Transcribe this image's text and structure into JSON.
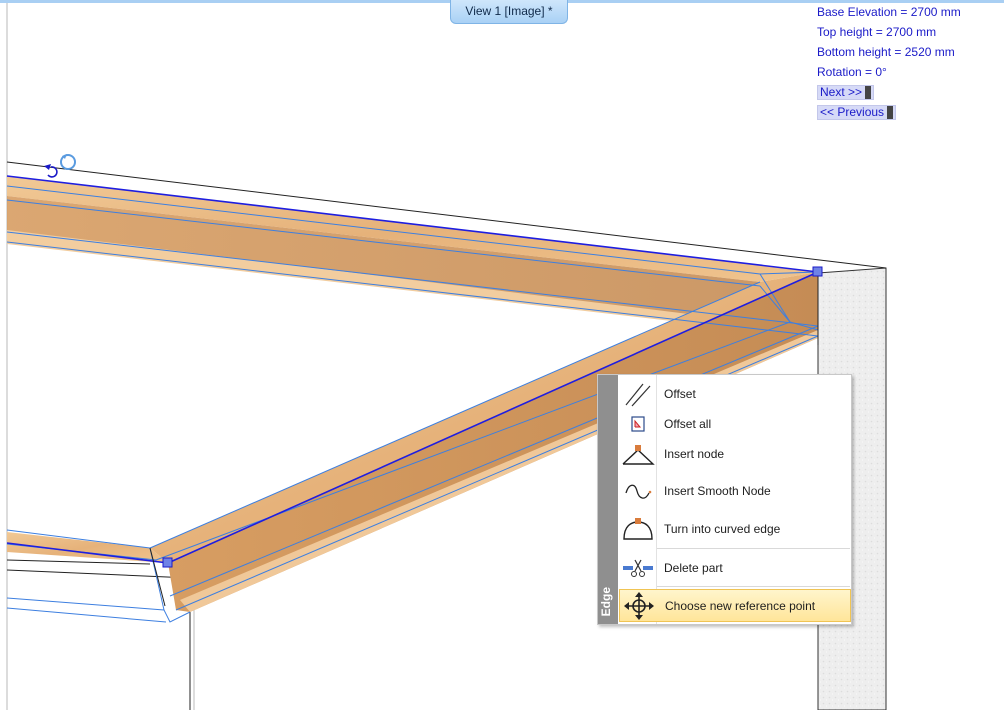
{
  "view_tab": {
    "label": "View 1 [Image] *"
  },
  "info_panel": {
    "lines": [
      "Base Elevation = 2700 mm",
      "Top height = 2700 mm",
      "Bottom height = 2520 mm",
      "Rotation = 0°"
    ],
    "next_label": "Next >>",
    "previous_label": "<< Previous"
  },
  "context_menu": {
    "title": "Edge",
    "items": [
      {
        "label": "Offset",
        "icon": "offset-icon"
      },
      {
        "label": "Offset all",
        "icon": "offset-all-icon"
      },
      {
        "label": "Insert node",
        "icon": "insert-node-icon"
      },
      {
        "label": "Insert Smooth Node",
        "icon": "insert-smooth-node-icon"
      },
      {
        "label": "Turn into curved edge",
        "icon": "curved-edge-icon"
      },
      {
        "label": "Delete part",
        "icon": "scissors-icon"
      },
      {
        "label": "Choose new reference point",
        "icon": "move-icon",
        "highlighted": true
      }
    ]
  },
  "colors": {
    "accent": "#1a1ac8",
    "wood": "#e8b781",
    "wood_dark": "#c48a51",
    "selection_blue": "#3d7fe0",
    "highlight": "#ffe59a"
  }
}
